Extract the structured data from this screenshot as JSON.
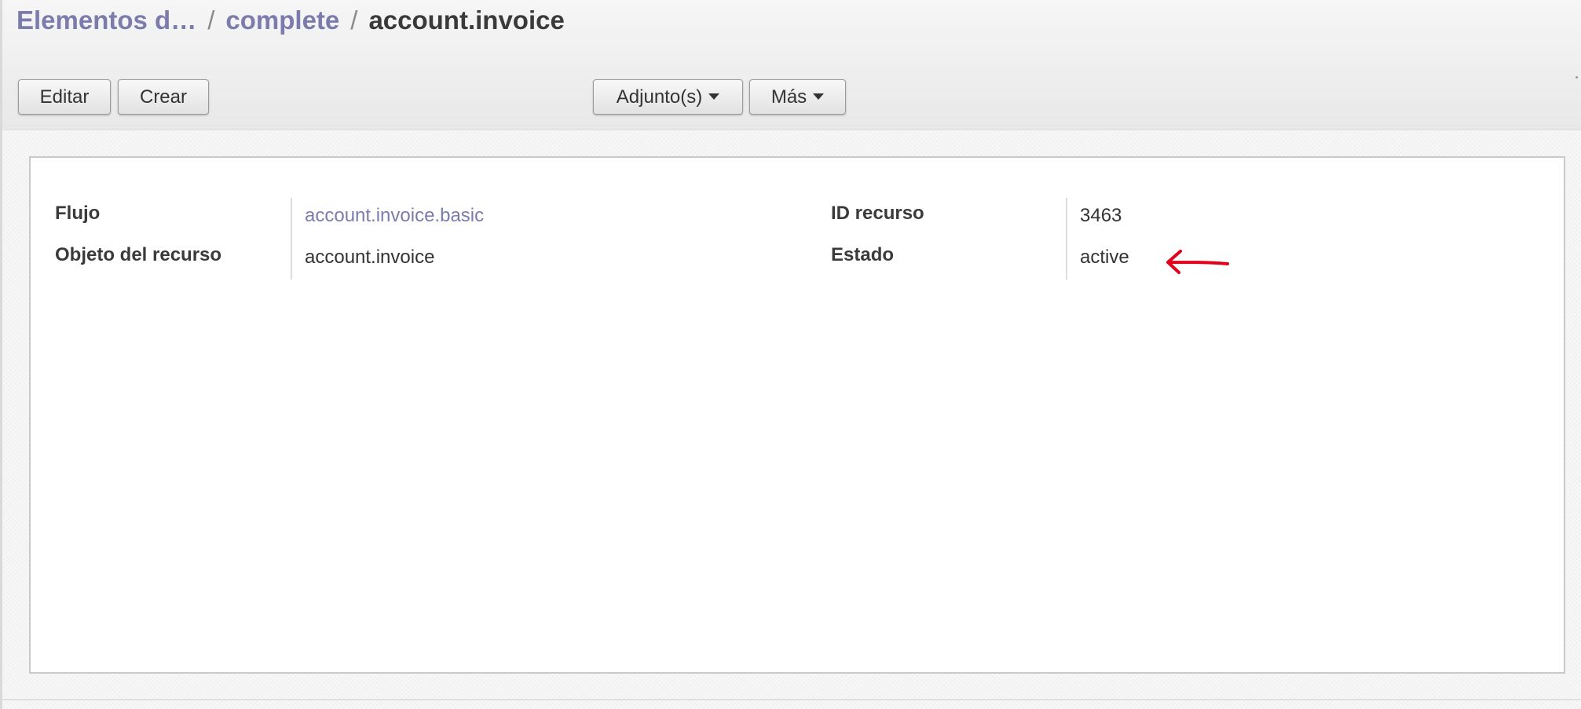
{
  "breadcrumb": {
    "items": [
      {
        "label": "Elementos d…"
      },
      {
        "label": "complete"
      }
    ],
    "separator": "/",
    "current": "account.invoice"
  },
  "toolbar": {
    "edit_label": "Editar",
    "create_label": "Crear",
    "attachments_label": "Adjunto(s)",
    "more_label": "Más"
  },
  "form": {
    "flow_label": "Flujo",
    "flow_value": "account.invoice.basic",
    "resource_object_label": "Objeto del recurso",
    "resource_object_value": "account.invoice",
    "resource_id_label": "ID recurso",
    "resource_id_value": "3463",
    "state_label": "Estado",
    "state_value": "active"
  },
  "colors": {
    "link": "#7c7bad",
    "annotation_arrow": "#e3001b"
  }
}
